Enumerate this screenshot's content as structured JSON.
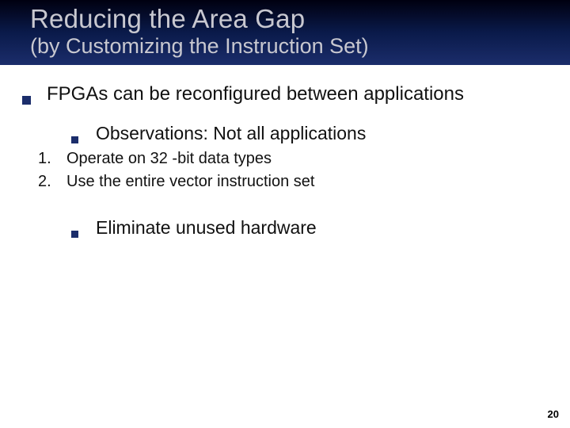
{
  "header": {
    "title": "Reducing the Area Gap",
    "subtitle": "(by Customizing the Instruction Set)"
  },
  "bullets": {
    "main": "FPGAs can be reconfigured between applications",
    "observations_label": "Observations: Not all applications",
    "numbered": [
      {
        "n": "1.",
        "text": "Operate on 32 -bit data types"
      },
      {
        "n": "2.",
        "text": "Use the entire vector instruction set"
      }
    ],
    "eliminate": "Eliminate unused hardware"
  },
  "page_number": "20"
}
